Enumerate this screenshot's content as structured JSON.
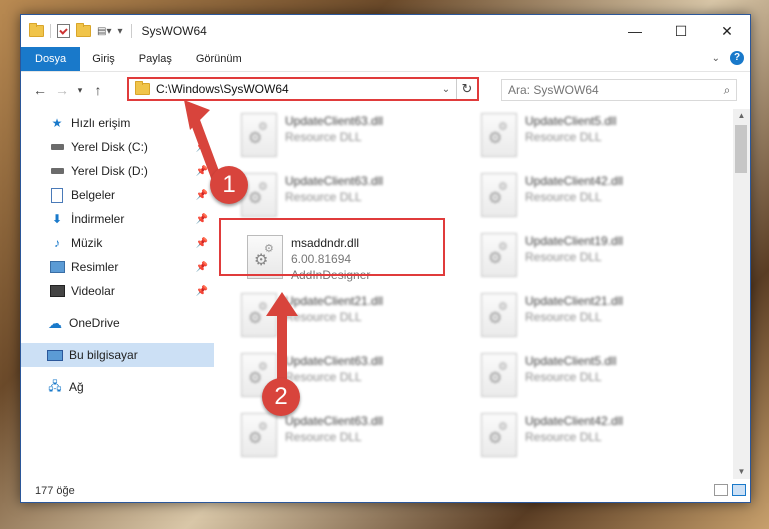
{
  "window": {
    "title": "SysWOW64"
  },
  "ribbon": {
    "tabs": [
      {
        "label": "Dosya",
        "active": true
      },
      {
        "label": "Giriş",
        "active": false
      },
      {
        "label": "Paylaş",
        "active": false
      },
      {
        "label": "Görünüm",
        "active": false
      }
    ],
    "help": "?"
  },
  "address": {
    "path": "C:\\Windows\\SysWOW64"
  },
  "search": {
    "placeholder": "Ara: SysWOW64"
  },
  "sidebar": {
    "items": [
      {
        "label": "Hızlı erişim",
        "icon": "star-icon",
        "pinned": false
      },
      {
        "label": "Yerel Disk (C:)",
        "icon": "drive-icon",
        "pinned": true
      },
      {
        "label": "Yerel Disk (D:)",
        "icon": "drive-icon",
        "pinned": true
      },
      {
        "label": "Belgeler",
        "icon": "documents-icon",
        "pinned": true
      },
      {
        "label": "İndirmeler",
        "icon": "downloads-icon",
        "pinned": true
      },
      {
        "label": "Müzik",
        "icon": "music-icon",
        "pinned": true
      },
      {
        "label": "Resimler",
        "icon": "pictures-icon",
        "pinned": true
      },
      {
        "label": "Videolar",
        "icon": "videos-icon",
        "pinned": true
      },
      {
        "label": "OneDrive",
        "icon": "cloud-icon",
        "pinned": false
      },
      {
        "label": "Bu bilgisayar",
        "icon": "computer-icon",
        "pinned": false,
        "selected": true
      },
      {
        "label": "Ağ",
        "icon": "network-icon",
        "pinned": false
      }
    ]
  },
  "files": [
    {
      "name": "UpdateClient63.dll",
      "sub1": "Resource DLL",
      "sub2": ""
    },
    {
      "name": "UpdateClient5.dll",
      "sub1": "Resource DLL",
      "sub2": ""
    },
    {
      "name": "UpdateClient63.dll",
      "sub1": "Resource DLL",
      "sub2": ""
    },
    {
      "name": "UpdateClient42.dll",
      "sub1": "Resource DLL",
      "sub2": ""
    },
    {
      "name": "msaddndr.dll",
      "sub1": "6.00.81694",
      "sub2": "AddInDesigner"
    },
    {
      "name": "UpdateClient19.dll",
      "sub1": "Resource DLL",
      "sub2": ""
    },
    {
      "name": "UpdateClient21.dll",
      "sub1": "Resource DLL",
      "sub2": ""
    },
    {
      "name": "UpdateClient21.dll",
      "sub1": "Resource DLL",
      "sub2": ""
    },
    {
      "name": "UpdateClient63.dll",
      "sub1": "Resource DLL",
      "sub2": ""
    },
    {
      "name": "UpdateClient5.dll",
      "sub1": "Resource DLL",
      "sub2": ""
    },
    {
      "name": "UpdateClient63.dll",
      "sub1": "Resource DLL",
      "sub2": ""
    },
    {
      "name": "UpdateClient42.dll",
      "sub1": "Resource DLL",
      "sub2": ""
    }
  ],
  "status": {
    "count": "177 öğe"
  },
  "annotations": {
    "badge1": "1",
    "badge2": "2",
    "color": "#d8443c"
  }
}
